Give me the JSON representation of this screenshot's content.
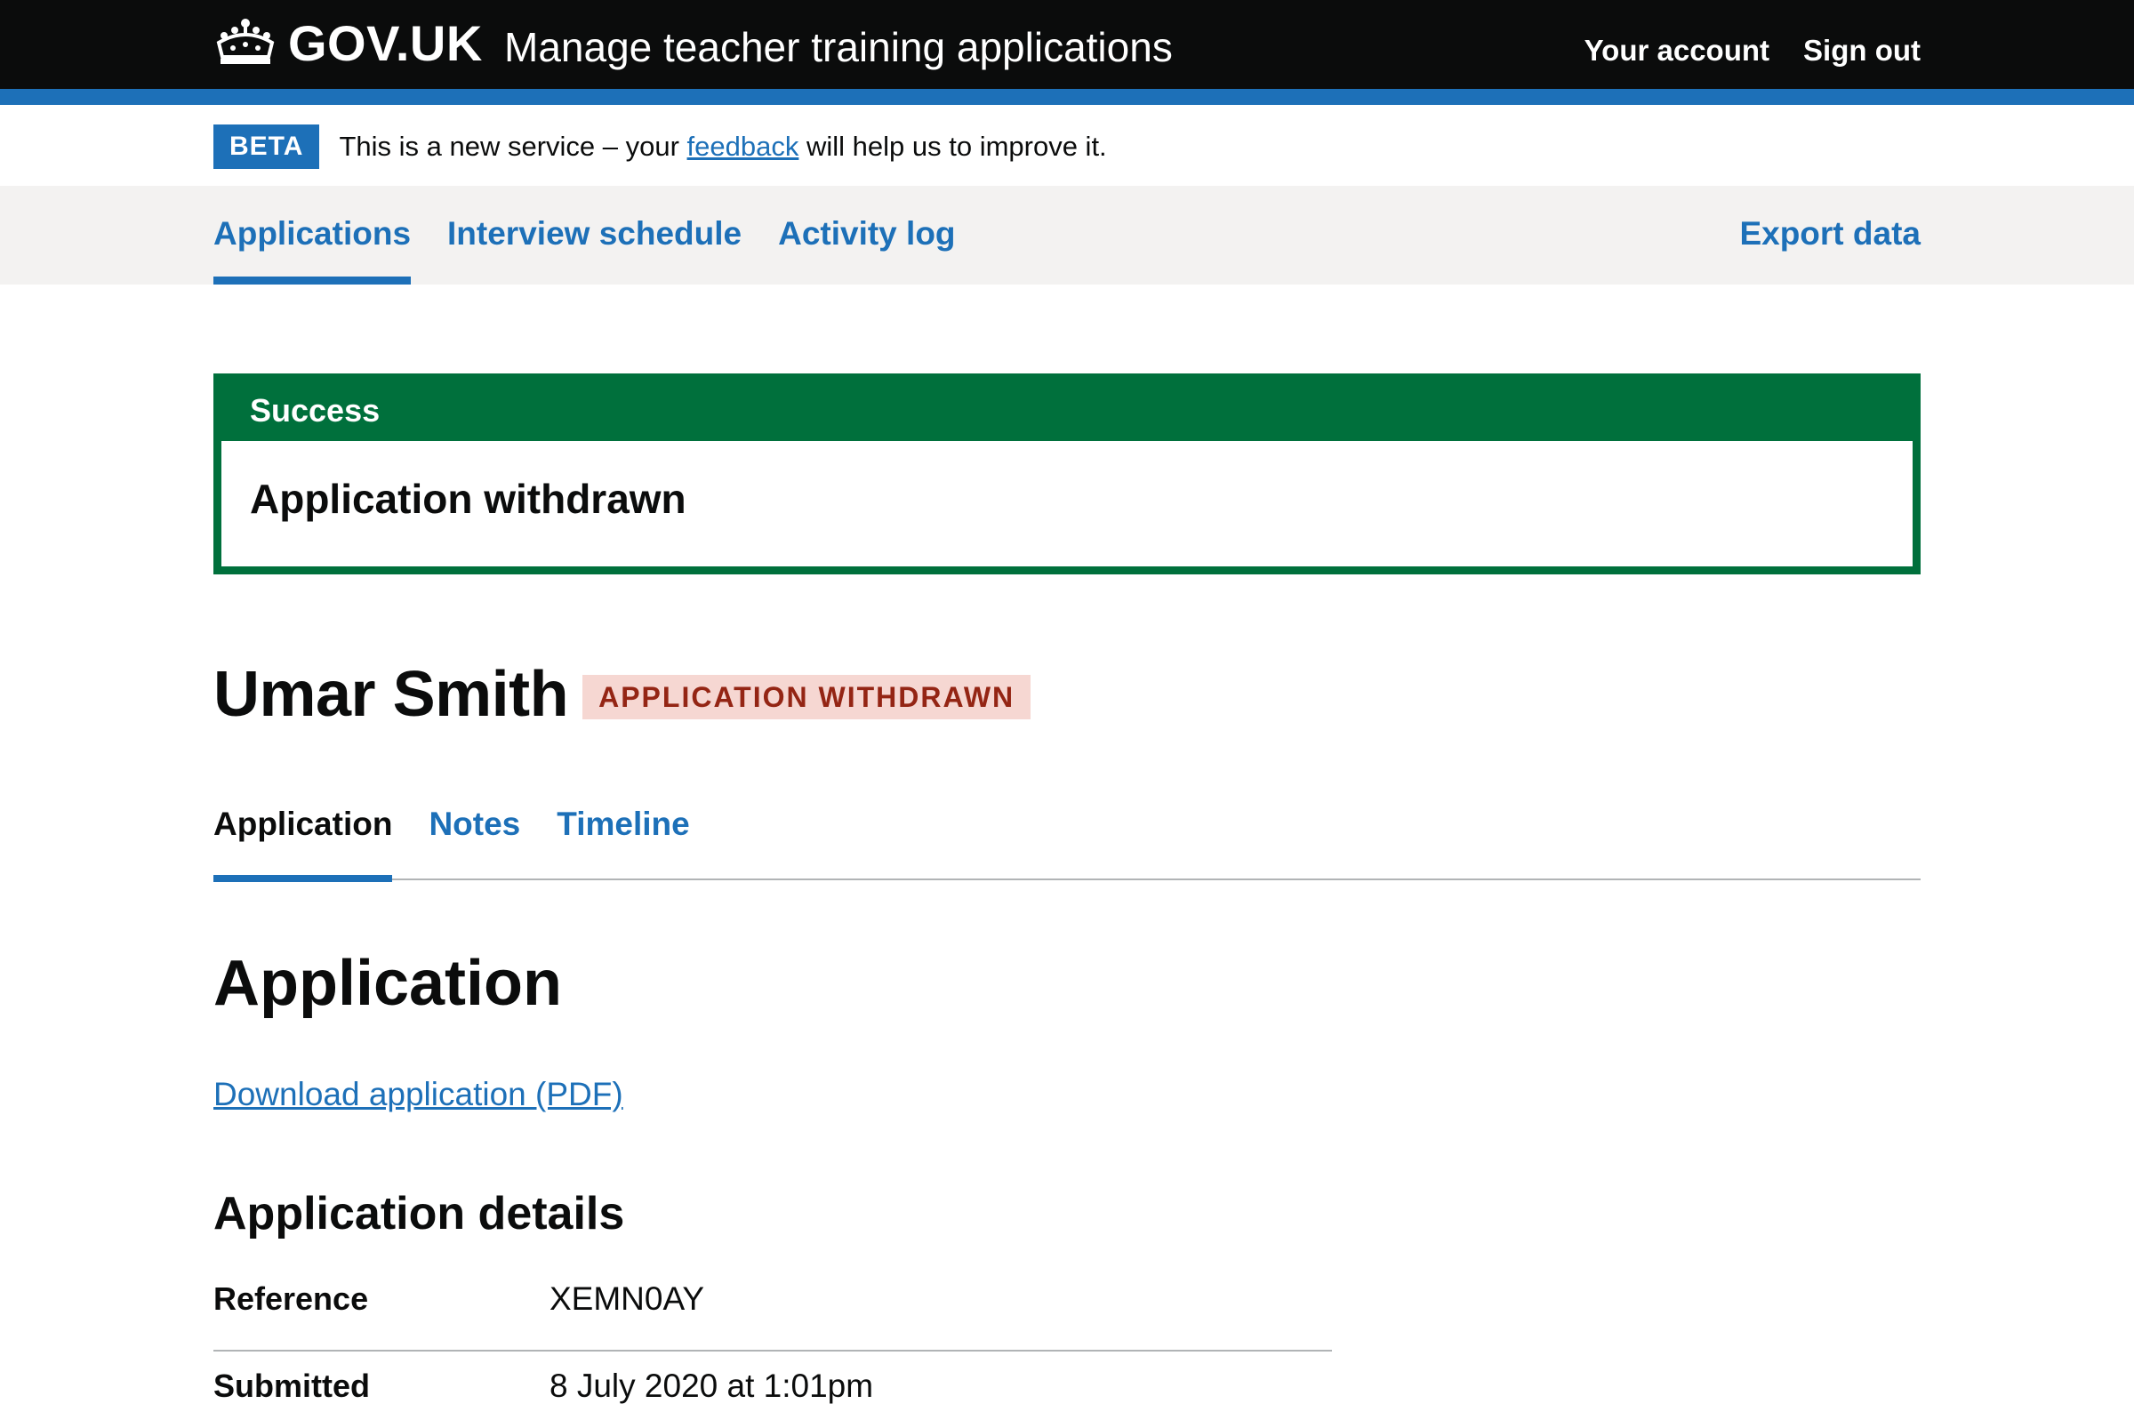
{
  "header": {
    "logo_text": "GOV.UK",
    "service_name": "Manage teacher training applications",
    "links": [
      "Your account",
      "Sign out"
    ]
  },
  "beta_banner": {
    "tag": "BETA",
    "text_before": "This is a new service – your ",
    "link_text": "feedback",
    "text_after": " will help us to improve it."
  },
  "primary_nav": {
    "items": [
      "Applications",
      "Interview schedule",
      "Activity log"
    ],
    "active": "Applications",
    "export_label": "Export data"
  },
  "success_banner": {
    "title": "Success",
    "message": "Application withdrawn"
  },
  "candidate": {
    "name": "Umar Smith",
    "status": "APPLICATION WITHDRAWN"
  },
  "sub_nav": {
    "items": [
      "Application",
      "Notes",
      "Timeline"
    ],
    "active": "Application"
  },
  "main": {
    "heading": "Application",
    "download_link": "Download application (PDF)",
    "section_heading": "Application details",
    "details": [
      {
        "key": "Reference",
        "value": "XEMN0AY"
      },
      {
        "key": "Submitted",
        "value": "8 July 2020 at 1:01pm"
      }
    ]
  },
  "colors": {
    "header_black": "#0b0c0c",
    "brand_blue": "#1d70b8",
    "success_green": "#00703c",
    "status_red_text": "#942514",
    "status_red_bg": "#f6d7d2",
    "nav_grey": "#f3f2f1"
  }
}
